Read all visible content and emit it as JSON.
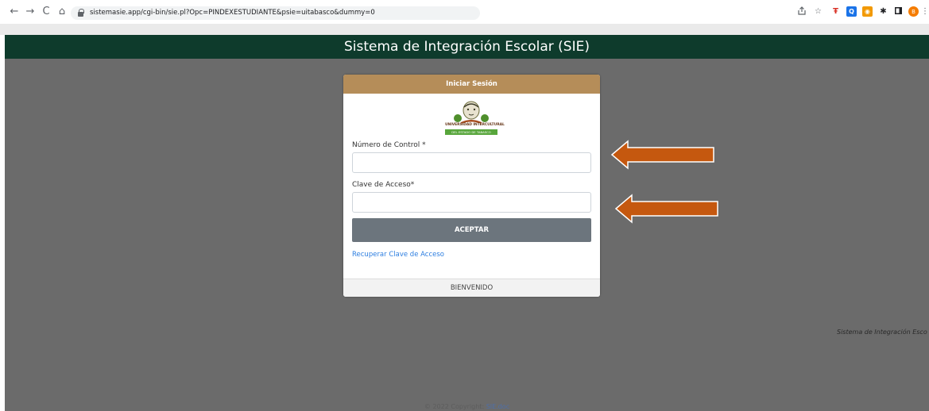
{
  "browser": {
    "nav": {
      "back": "←",
      "forward": "→",
      "reload": "C",
      "home": "⌂"
    },
    "url": "sistemasie.app/cgi-bin/sie.pl?Opc=PINDEXESTUDIANTE&psie=uitabasco&dummy=0",
    "icons": [
      "share-icon",
      "star-icon",
      "extension-icons",
      "puzzle-icon",
      "sidebar-icon",
      "profile-icon",
      "menu-icon"
    ]
  },
  "header": {
    "title": "Sistema de Integración Escolar (SIE)"
  },
  "login": {
    "title": "Iniciar Sesión",
    "logo_text": "UNIVERSIDAD INTERCULTURAL",
    "logo_subtext": "DEL ESTADO DE TABASCO",
    "control_label": "Número de Control *",
    "control_value": "",
    "password_label": "Clave de Acceso*",
    "password_value": "",
    "submit_label": "ACEPTAR",
    "recover_label": "Recuperar Clave de Acceso",
    "footer": "BIENVENIDO"
  },
  "side_caption": "Sistema de Integración Esco",
  "copyright": {
    "text": "© 2022 Copyright:",
    "link": "SIE.doc"
  },
  "colors": {
    "header_bg": "#0e3b2c",
    "page_bg": "#6b6b6b",
    "card_header_bg": "#b58d59",
    "button_bg": "#6c757d",
    "link": "#2d7ee0",
    "arrow": "#c5580f"
  }
}
